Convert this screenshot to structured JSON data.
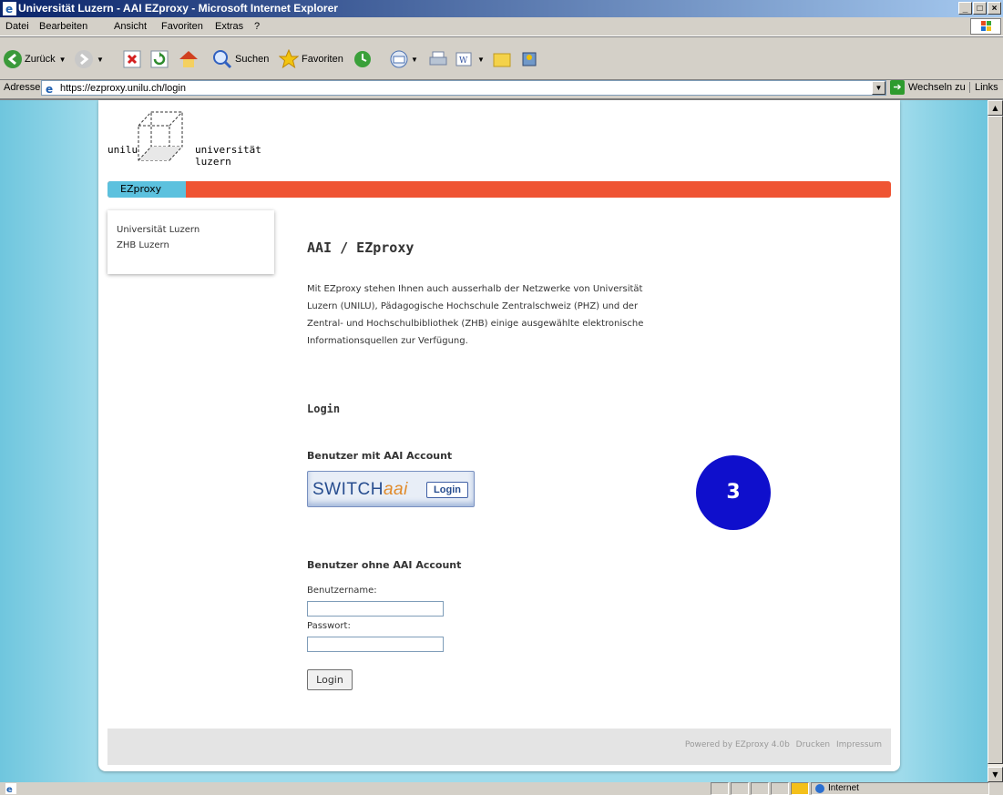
{
  "window": {
    "title": "Universität Luzern - AAI EZproxy - Microsoft Internet Explorer",
    "buttons": [
      "_",
      "□",
      "×"
    ]
  },
  "menu": [
    "Datei",
    "Bearbeiten",
    "Ansicht",
    "Favoriten",
    "Extras",
    "?"
  ],
  "toolbar": {
    "back_label": "Zurück",
    "search_label": "Suchen",
    "favorites_label": "Favoriten"
  },
  "address": {
    "label": "Adresse",
    "url": "https://ezproxy.unilu.ch/login",
    "go_label": "Wechseln zu",
    "links_label": "Links"
  },
  "site": {
    "logo_short": "unilu",
    "logo_name": "universität luzern",
    "tab_label": "EZproxy",
    "colors": {
      "accent_orange": "#ef5433",
      "accent_blue": "#5cc1de"
    }
  },
  "sidebar": {
    "items": [
      "Universität Luzern",
      "ZHB Luzern"
    ]
  },
  "main": {
    "heading": "AAI / EZproxy",
    "intro_lines": [
      "Mit EZproxy stehen Ihnen auch ausserhalb der Netzwerke von Universität",
      "Luzern (UNILU), Pädagogische Hochschule Zentralschweiz (PHZ) und der",
      "Zentral- und Hochschulbibliothek (ZHB) einige ausgewählte elektronische",
      "Informationsquellen zur Verfügung."
    ],
    "login_heading": "Login",
    "aai_heading": "Benutzer mit AAI Account",
    "switch_brand": "SWITCH",
    "switch_brand_suffix": "aai",
    "switch_login": "Login",
    "badge": "3",
    "noaai_heading": "Benutzer ohne AAI Account",
    "username_label": "Benutzername:",
    "username_value": "",
    "password_label": "Passwort:",
    "password_value": "",
    "login_button": "Login"
  },
  "footer": {
    "powered": "Powered by EZproxy 4.0b",
    "print": "Drucken",
    "imprint": "Impressum"
  },
  "status": {
    "zone": "Internet"
  }
}
